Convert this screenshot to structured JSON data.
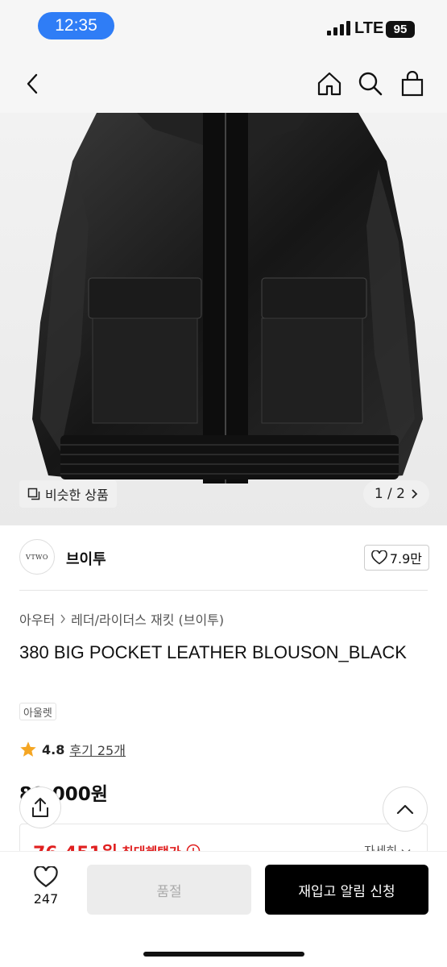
{
  "status": {
    "time": "12:35",
    "network": "LTE",
    "battery": "95"
  },
  "nav": {
    "icons": [
      "back-icon",
      "home-icon",
      "search-icon",
      "shopping-bag-icon"
    ]
  },
  "hero": {
    "similar_label": "비슷한 상품",
    "pager": "1 / 2",
    "image_subject": "black leather blouson jacket"
  },
  "brand": {
    "logo_text": "VTWO",
    "name": "브이투",
    "likes": "7.9만"
  },
  "breadcrumb": {
    "level1": "아우터",
    "level2": "레더/라이더스 재킷 (브이투)"
  },
  "product": {
    "title": "380 BIG POCKET LEATHER BLOUSON_BLACK",
    "tag": "아울렛",
    "rating": "4.8",
    "reviews": "후기 25개",
    "price": "89,000원"
  },
  "benefit": {
    "price": "76,451원",
    "label": "최대혜택가",
    "detail": "자세히"
  },
  "bottom": {
    "wish_count": "247",
    "soldout_label": "품절",
    "restock_label": "재입고 알림 신청"
  },
  "colors": {
    "accent_blue": "#2f7df6",
    "sale_red": "#e02020",
    "cta_black": "#000000",
    "star": "#f5a623"
  }
}
